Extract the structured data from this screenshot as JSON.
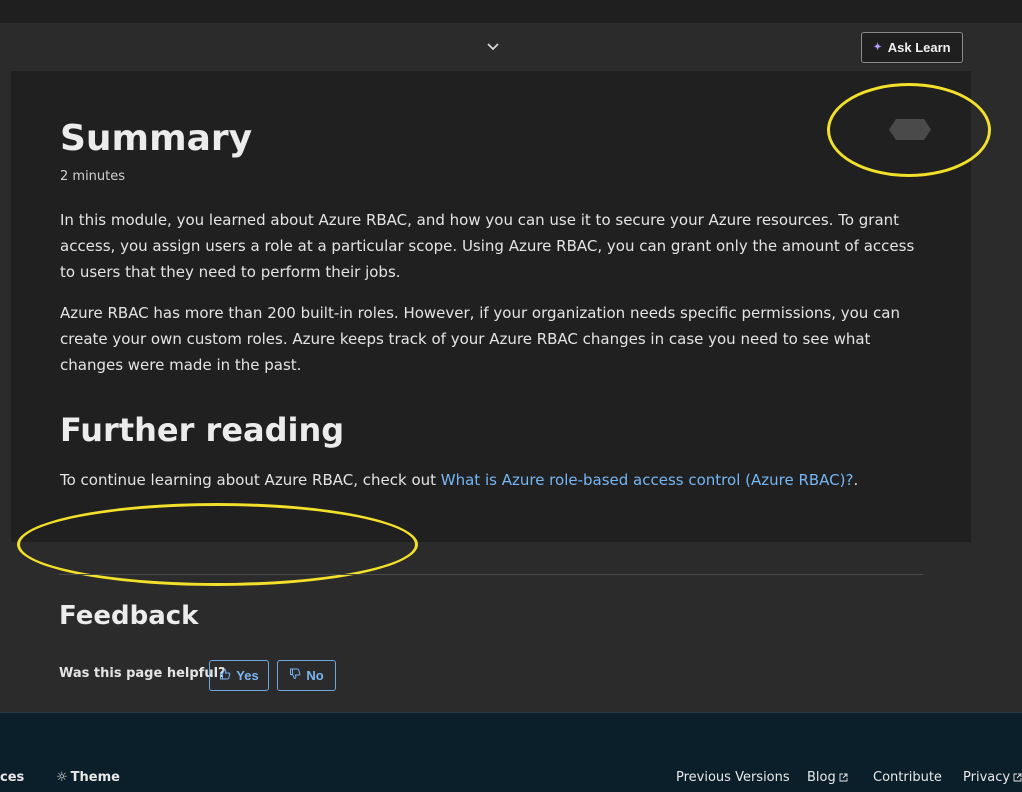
{
  "header": {
    "ask_learn_label": "Ask Learn",
    "chevron_icon": "chevron-down-icon",
    "sparkle_icon": "sparkle-icon"
  },
  "summary": {
    "title": "Summary",
    "duration": "2 minutes",
    "paragraph1": "In this module, you learned about Azure RBAC, and how you can use it to secure your Azure resources. To grant access, you assign users a role at a particular scope. Using Azure RBAC, you can grant only the amount of access to users that they need to perform their jobs.",
    "paragraph2": "Azure RBAC has more than 200 built-in roles. However, if your organization needs specific permissions, you can create your own custom roles. Azure keeps track of your Azure RBAC changes in case you need to see what changes were made in the past."
  },
  "further_reading": {
    "title": "Further reading",
    "intro": "To continue learning about Azure RBAC, check out ",
    "link_text": "What is Azure role-based access control (Azure RBAC)?",
    "suffix": "."
  },
  "feedback": {
    "title": "Feedback",
    "question": "Was this page helpful?",
    "yes_label": "Yes",
    "no_label": "No"
  },
  "footer": {
    "services_fragment": "ces",
    "theme_label": "Theme",
    "previous_versions": "Previous Versions",
    "blog": "Blog",
    "contribute": "Contribute",
    "privacy": "Privacy"
  },
  "colors": {
    "background": "#2b2b2b",
    "panel": "#202020",
    "link": "#75b6f5",
    "annotation": "#f2e02a",
    "footer": "#0b1f2b"
  }
}
